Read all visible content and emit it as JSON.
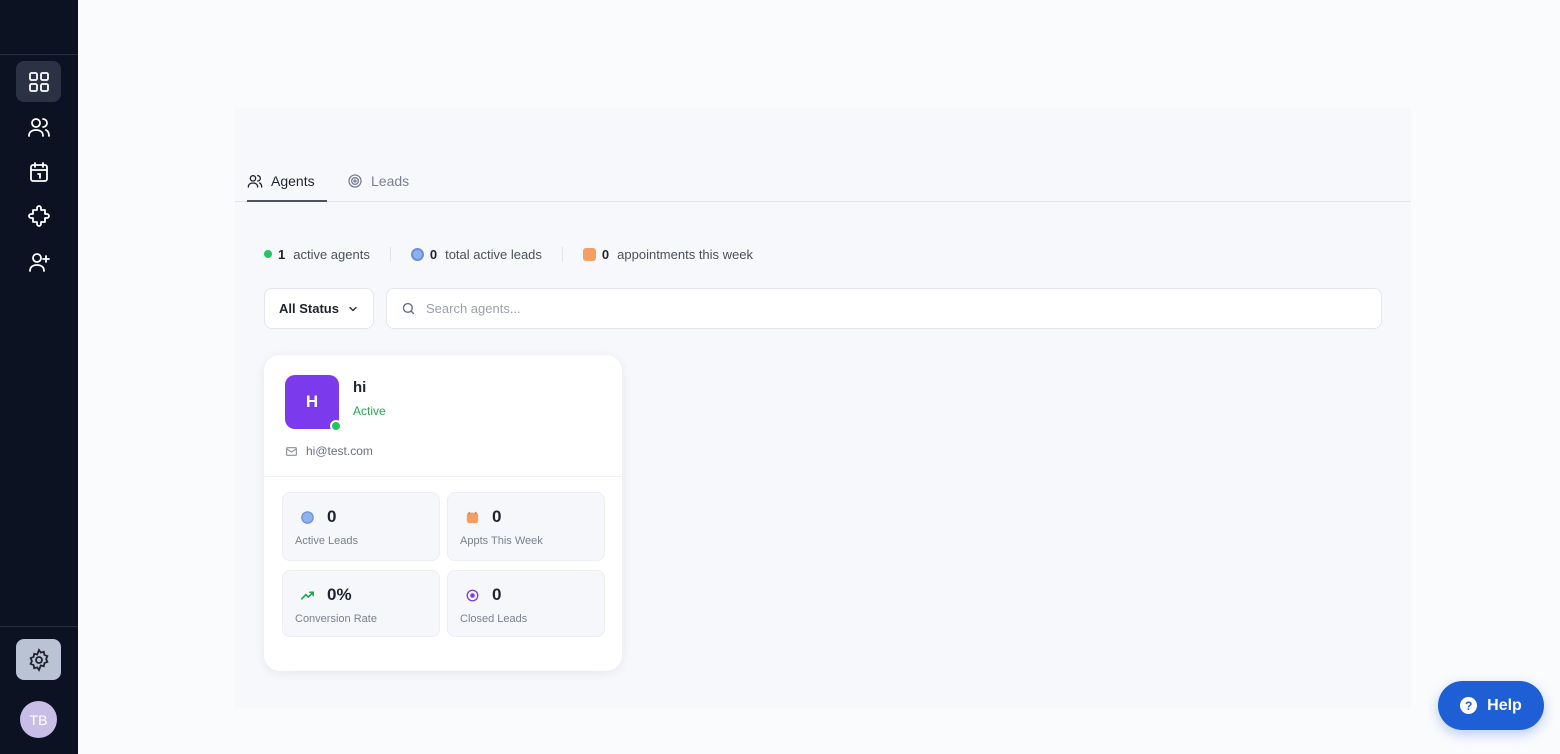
{
  "sidebar": {
    "items": [
      {
        "name": "dashboard",
        "icon": "grid-icon",
        "active": true
      },
      {
        "name": "agents",
        "icon": "users-icon",
        "active": false
      },
      {
        "name": "calendar",
        "icon": "calendar-icon",
        "active": false
      },
      {
        "name": "integrations",
        "icon": "puzzle-icon",
        "active": false
      },
      {
        "name": "invite",
        "icon": "user-plus-icon",
        "active": false
      }
    ],
    "settings_icon": "gear-icon",
    "user_initials": "TB"
  },
  "tabs": [
    {
      "label": "Agents",
      "icon": "users-icon",
      "active": true
    },
    {
      "label": "Leads",
      "icon": "target-icon",
      "active": false
    }
  ],
  "stats": {
    "active_agents": {
      "value": "1",
      "label": "active agents"
    },
    "total_leads": {
      "value": "0",
      "label": "total active leads"
    },
    "appointments": {
      "value": "0",
      "label": "appointments this week"
    }
  },
  "filter": {
    "label": "All Status"
  },
  "search": {
    "placeholder": "Search agents...",
    "value": ""
  },
  "agent_card": {
    "initial": "H",
    "name": "hi",
    "status": "Active",
    "email": "hi@test.com",
    "metrics": {
      "active_leads": {
        "value": "0",
        "label": "Active Leads"
      },
      "appts_week": {
        "value": "0",
        "label": "Appts This Week"
      },
      "conversion": {
        "value": "0%",
        "label": "Conversion Rate"
      },
      "closed": {
        "value": "0",
        "label": "Closed Leads"
      }
    }
  },
  "help": {
    "label": "Help",
    "glyph": "?"
  },
  "colors": {
    "sidebar_bg": "#0c1222",
    "accent_purple": "#7c3aed",
    "status_green": "#22c55e",
    "help_blue": "#1f5fd6"
  }
}
